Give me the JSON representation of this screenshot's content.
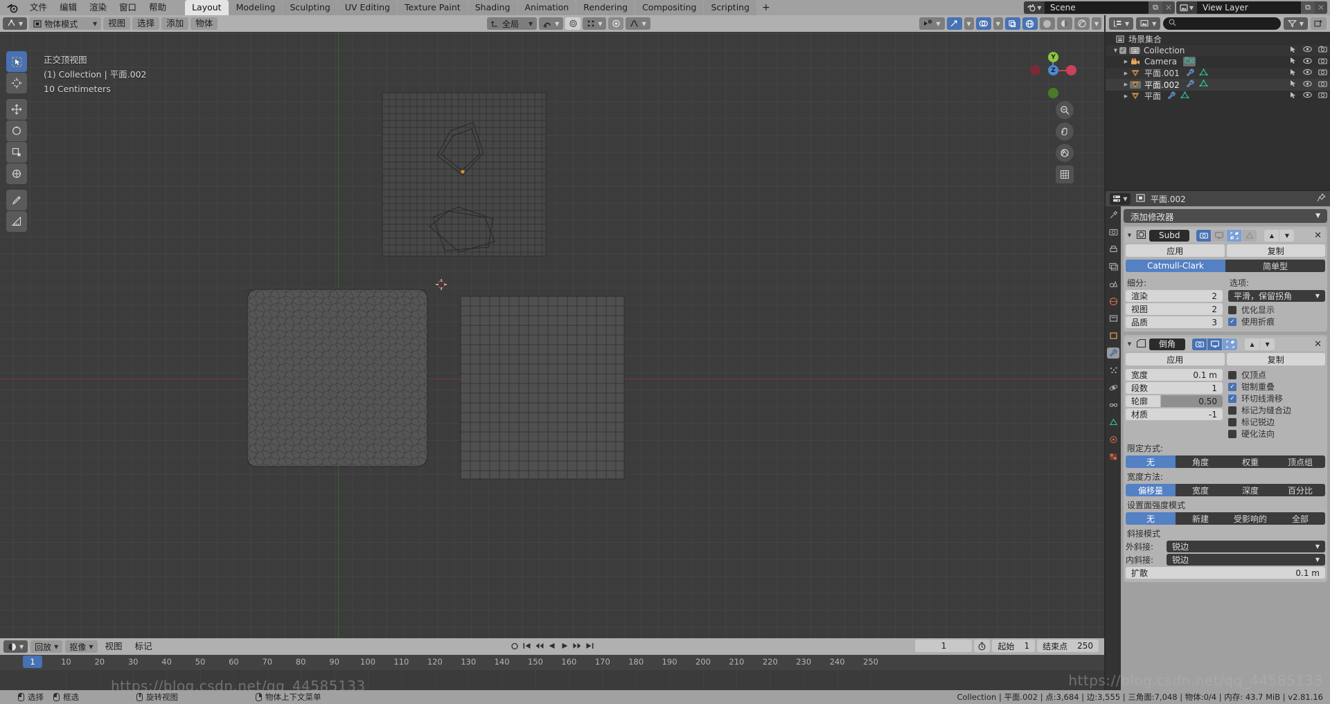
{
  "topbar": {
    "logo_icon": "blender-logo-icon",
    "menus": [
      "文件",
      "编辑",
      "渲染",
      "窗口",
      "帮助"
    ],
    "workspace_tabs": [
      {
        "label": "Layout",
        "active": true
      },
      {
        "label": "Modeling",
        "active": false
      },
      {
        "label": "Sculpting",
        "active": false
      },
      {
        "label": "UV Editing",
        "active": false
      },
      {
        "label": "Texture Paint",
        "active": false
      },
      {
        "label": "Shading",
        "active": false
      },
      {
        "label": "Animation",
        "active": false
      },
      {
        "label": "Rendering",
        "active": false
      },
      {
        "label": "Compositing",
        "active": false
      },
      {
        "label": "Scripting",
        "active": false
      }
    ],
    "add_workspace_label": "+",
    "scene_name": "Scene",
    "view_layer_name": "View Layer"
  },
  "viewport": {
    "header": {
      "mode": "物体模式",
      "menus": [
        "视图",
        "选择",
        "添加",
        "物体"
      ],
      "transform_orientation": "全局",
      "snap_icon": "magnet-icon",
      "proportional_icon": "proportional-edit-icon",
      "pivot_icon": "pivot-point-icon",
      "falloff_icon": "falloff-curve-icon",
      "visibility_icon": "object-types-visibility-icon",
      "gizmo_icon": "gizmo-icon",
      "overlays_icon": "overlays-icon",
      "xray_icon": "xray-icon",
      "shading_wireframe_icon": "shading-wireframe-icon",
      "shading_solid_icon": "shading-solid-icon",
      "shading_material_icon": "shading-material-icon",
      "shading_rendered_icon": "shading-rendered-icon"
    },
    "overlay": {
      "view_name": "正交顶视图",
      "collection_object": "(1) Collection | 平面.002",
      "grid_scale": "10 Centimeters"
    },
    "tools": [
      {
        "name": "tweak-select-tool",
        "icon": "cursor-arrow-icon",
        "active": true
      },
      {
        "name": "cursor-tool",
        "icon": "crosshair-icon",
        "active": false
      },
      {
        "name": "move-tool",
        "icon": "move-arrows-icon",
        "active": false
      },
      {
        "name": "rotate-tool",
        "icon": "rotate-icon",
        "active": false
      },
      {
        "name": "scale-tool",
        "icon": "scale-icon",
        "active": false
      },
      {
        "name": "transform-tool",
        "icon": "transform-icon",
        "active": false
      },
      {
        "name": "annotate-tool",
        "icon": "pencil-icon",
        "active": false
      },
      {
        "name": "measure-tool",
        "icon": "ruler-icon",
        "active": false
      }
    ],
    "gizmo": {
      "x_label": "X",
      "y_label": "Y",
      "z_label": "Z"
    },
    "nav_buttons": [
      "zoom-icon",
      "pan-hand-icon",
      "camera-view-icon",
      "ortho-persp-icon"
    ]
  },
  "timeline": {
    "editor_icon": "timeline-editor-icon",
    "menus": [
      "回放",
      "抠像",
      "视图",
      "标记"
    ],
    "ruler_ticks": [
      10,
      20,
      30,
      40,
      50,
      60,
      70,
      80,
      90,
      100,
      110,
      120,
      130,
      140,
      150,
      160,
      170,
      180,
      190,
      200,
      210,
      220,
      230,
      240,
      250
    ],
    "current_frame_marker": "1",
    "playback_controls": [
      "record-icon",
      "jump-start-icon",
      "prev-keyframe-icon",
      "play-reverse-icon",
      "play-icon",
      "next-keyframe-icon",
      "jump-end-icon"
    ],
    "current_frame_value": "1",
    "start_label": "起始",
    "start_value": "1",
    "end_label": "结束点",
    "end_value": "250",
    "auto_key_icon": "stopwatch-icon"
  },
  "outliner": {
    "display_mode_icon": "outliner-display-mode-icon",
    "filter_id_icon": "filter-id-icon",
    "search_placeholder": "",
    "search_icon": "search-icon",
    "filter_icon": "funnel-icon",
    "new_collection_icon": "new-collection-icon",
    "scene_collection_label": "场景集合",
    "items": [
      {
        "label": "Collection",
        "icon": "collection-icon",
        "depth": 0,
        "has_checkbox": true,
        "has_expand": true,
        "selected": false,
        "badges": []
      },
      {
        "label": "Camera",
        "icon": "camera-object-icon",
        "depth": 1,
        "has_checkbox": false,
        "has_expand": true,
        "selected": false,
        "badges": [
          "camera-data-icon"
        ]
      },
      {
        "label": "平面.001",
        "icon": "mesh-object-icon",
        "depth": 1,
        "has_checkbox": false,
        "has_expand": true,
        "selected": false,
        "badges": [
          "wrench-modifier-icon",
          "mesh-data-icon"
        ]
      },
      {
        "label": "平面.002",
        "icon": "mesh-object-icon",
        "depth": 1,
        "has_checkbox": false,
        "has_expand": true,
        "selected": true,
        "badges": [
          "wrench-modifier-icon",
          "mesh-data-icon"
        ]
      },
      {
        "label": "平面",
        "icon": "mesh-object-icon",
        "depth": 1,
        "has_checkbox": false,
        "has_expand": true,
        "selected": false,
        "badges": [
          "wrench-modifier-icon",
          "mesh-data-icon"
        ]
      }
    ],
    "row_toggles": [
      "select-arrow-icon",
      "eye-icon",
      "camera-render-icon"
    ]
  },
  "properties": {
    "breadcrumb_object": "平面.002",
    "breadcrumb_icon": "object-icon",
    "pin_icon": "pin-icon",
    "editor_icon": "properties-editor-icon",
    "tabs": [
      {
        "name": "tool-tab",
        "icon": "tool-wrench-screwdriver-icon",
        "active": false
      },
      {
        "name": "render-tab",
        "icon": "camera-back-icon",
        "active": false
      },
      {
        "name": "output-tab",
        "icon": "printer-icon",
        "active": false
      },
      {
        "name": "view-layer-tab",
        "icon": "images-icon",
        "active": false
      },
      {
        "name": "scene-tab",
        "icon": "cone-sphere-icon",
        "active": false
      },
      {
        "name": "world-tab",
        "icon": "world-globe-icon",
        "active": false
      },
      {
        "name": "collection-tab",
        "icon": "collection-box-icon",
        "active": false
      },
      {
        "name": "object-tab",
        "icon": "orange-square-icon",
        "active": false
      },
      {
        "name": "modifier-tab",
        "icon": "wrench-icon",
        "active": true
      },
      {
        "name": "particles-tab",
        "icon": "particles-icon",
        "active": false
      },
      {
        "name": "physics-tab",
        "icon": "physics-orbit-icon",
        "active": false
      },
      {
        "name": "constraints-tab",
        "icon": "constraint-icon",
        "active": false
      },
      {
        "name": "data-tab",
        "icon": "green-triangle-data-icon",
        "active": false
      },
      {
        "name": "material-tab",
        "icon": "material-sphere-icon",
        "active": false
      },
      {
        "name": "texture-tab",
        "icon": "checker-texture-icon",
        "active": false
      }
    ],
    "add_modifier_label": "添加修改器",
    "modifiers": [
      {
        "name": "Subd",
        "type_icon": "subsurf-modifier-icon",
        "display_toggles": [
          {
            "name": "render-toggle",
            "icon": "camera-icon",
            "state": "on"
          },
          {
            "name": "realtime-toggle",
            "icon": "monitor-icon",
            "state": "off-light"
          },
          {
            "name": "edit-mode-toggle",
            "icon": "edit-mode-icon",
            "state": "on-light"
          },
          {
            "name": "on-cage-toggle",
            "icon": "cage-icon",
            "state": "disabled"
          }
        ],
        "move_up_icon": "triangle-up-icon",
        "move_down_icon": "triangle-down-icon",
        "close_icon": "x-icon",
        "apply_label": "应用",
        "duplicate_label": "复制",
        "algorithm_tabs": [
          {
            "label": "Catmull-Clark",
            "active": true
          },
          {
            "label": "简单型",
            "active": false
          }
        ],
        "subdivisions_label": "细分:",
        "options_label": "选项:",
        "fields": [
          {
            "label": "渲染",
            "value": "2"
          },
          {
            "label": "视图",
            "value": "2"
          },
          {
            "label": "品质",
            "value": "3"
          }
        ],
        "uv_smooth": "平滑，保留拐角",
        "checkboxes": [
          {
            "label": "优化显示",
            "checked": false
          },
          {
            "label": "使用折痕",
            "checked": true
          }
        ]
      },
      {
        "name": "倒角",
        "type_icon": "bevel-modifier-icon",
        "display_toggles": [
          {
            "name": "render-toggle",
            "icon": "camera-icon",
            "state": "on"
          },
          {
            "name": "realtime-toggle",
            "icon": "monitor-icon",
            "state": "on"
          },
          {
            "name": "edit-mode-toggle",
            "icon": "edit-mode-icon",
            "state": "on-light"
          }
        ],
        "move_up_icon": "triangle-up-icon",
        "move_down_icon": "triangle-down-icon",
        "close_icon": "x-icon",
        "apply_label": "应用",
        "duplicate_label": "复制",
        "fields": [
          {
            "label": "宽度",
            "value": "0.1 m",
            "slider": false
          },
          {
            "label": "段数",
            "value": "1",
            "slider": false
          },
          {
            "label": "轮廓",
            "value": "0.50",
            "slider": true
          },
          {
            "label": "材质",
            "value": "-1",
            "slider": false
          }
        ],
        "checkboxes": [
          {
            "label": "仅顶点",
            "checked": false
          },
          {
            "label": "钳制重叠",
            "checked": true
          },
          {
            "label": "环切线滑移",
            "checked": true
          },
          {
            "label": "标记为缝合边",
            "checked": false
          },
          {
            "label": "标记锐边",
            "checked": false
          },
          {
            "label": "硬化法向",
            "checked": false
          }
        ],
        "limit_method_label": "限定方式:",
        "limit_method_options": [
          {
            "label": "无",
            "active": true
          },
          {
            "label": "角度",
            "active": false
          },
          {
            "label": "权重",
            "active": false
          },
          {
            "label": "顶点组",
            "active": false
          }
        ],
        "width_method_label": "宽度方法:",
        "width_method_options": [
          {
            "label": "偏移量",
            "active": true
          },
          {
            "label": "宽度",
            "active": false
          },
          {
            "label": "深度",
            "active": false
          },
          {
            "label": "百分比",
            "active": false
          }
        ],
        "face_strength_label": "设置面强度模式",
        "face_strength_options": [
          {
            "label": "无",
            "active": true
          },
          {
            "label": "新建",
            "active": false
          },
          {
            "label": "受影响的",
            "active": false
          },
          {
            "label": "全部",
            "active": false
          }
        ],
        "miter_label": "斜接模式",
        "miter_rows": [
          {
            "label": "外斜接:",
            "value": "锐边"
          },
          {
            "label": "内斜接:",
            "value": "锐边"
          }
        ],
        "spread_label": "扩散",
        "spread_value": "0.1 m"
      }
    ]
  },
  "statusbar": {
    "hints": [
      {
        "mouse": "left",
        "label": "选择",
        "extra_mouse": "left-drag",
        "extra_label": "框选"
      },
      {
        "mouse": "middle",
        "label": "旋转视图"
      },
      {
        "mouse": "right",
        "label": "物体上下文菜单"
      }
    ],
    "stats": "Collection | 平面.002 | 点:3,684 | 边:3,555 | 三角面:7,048 | 物体:0/4  | 内存: 43.7 MiB | v2.81.16"
  },
  "watermark": "https://blog.csdn.net/qq_44585133"
}
